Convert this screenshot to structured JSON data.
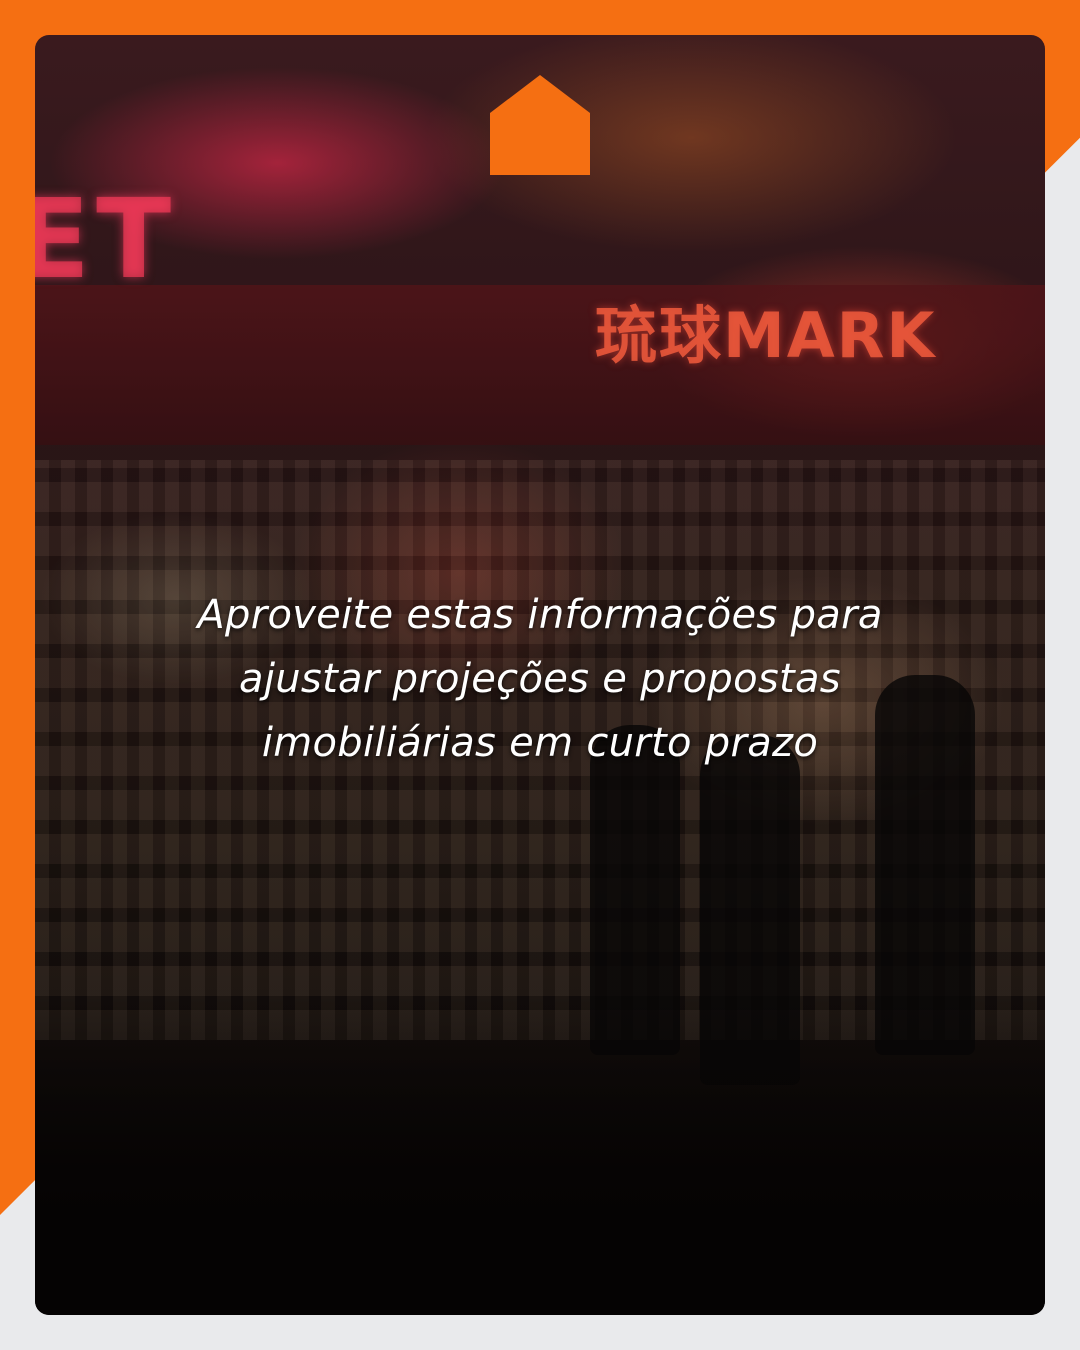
{
  "card": {
    "caption": "Aproveite estas informações para ajustar projeções e propostas imobiliárias em curto prazo"
  },
  "background_photo": {
    "banner_text": "琉球MARK",
    "sign_text": "ET"
  },
  "colors": {
    "accent": "#f56f12",
    "page_background": "#e9eaec",
    "caption_text": "#ffffff"
  },
  "icons": {
    "logo": "house-icon"
  }
}
